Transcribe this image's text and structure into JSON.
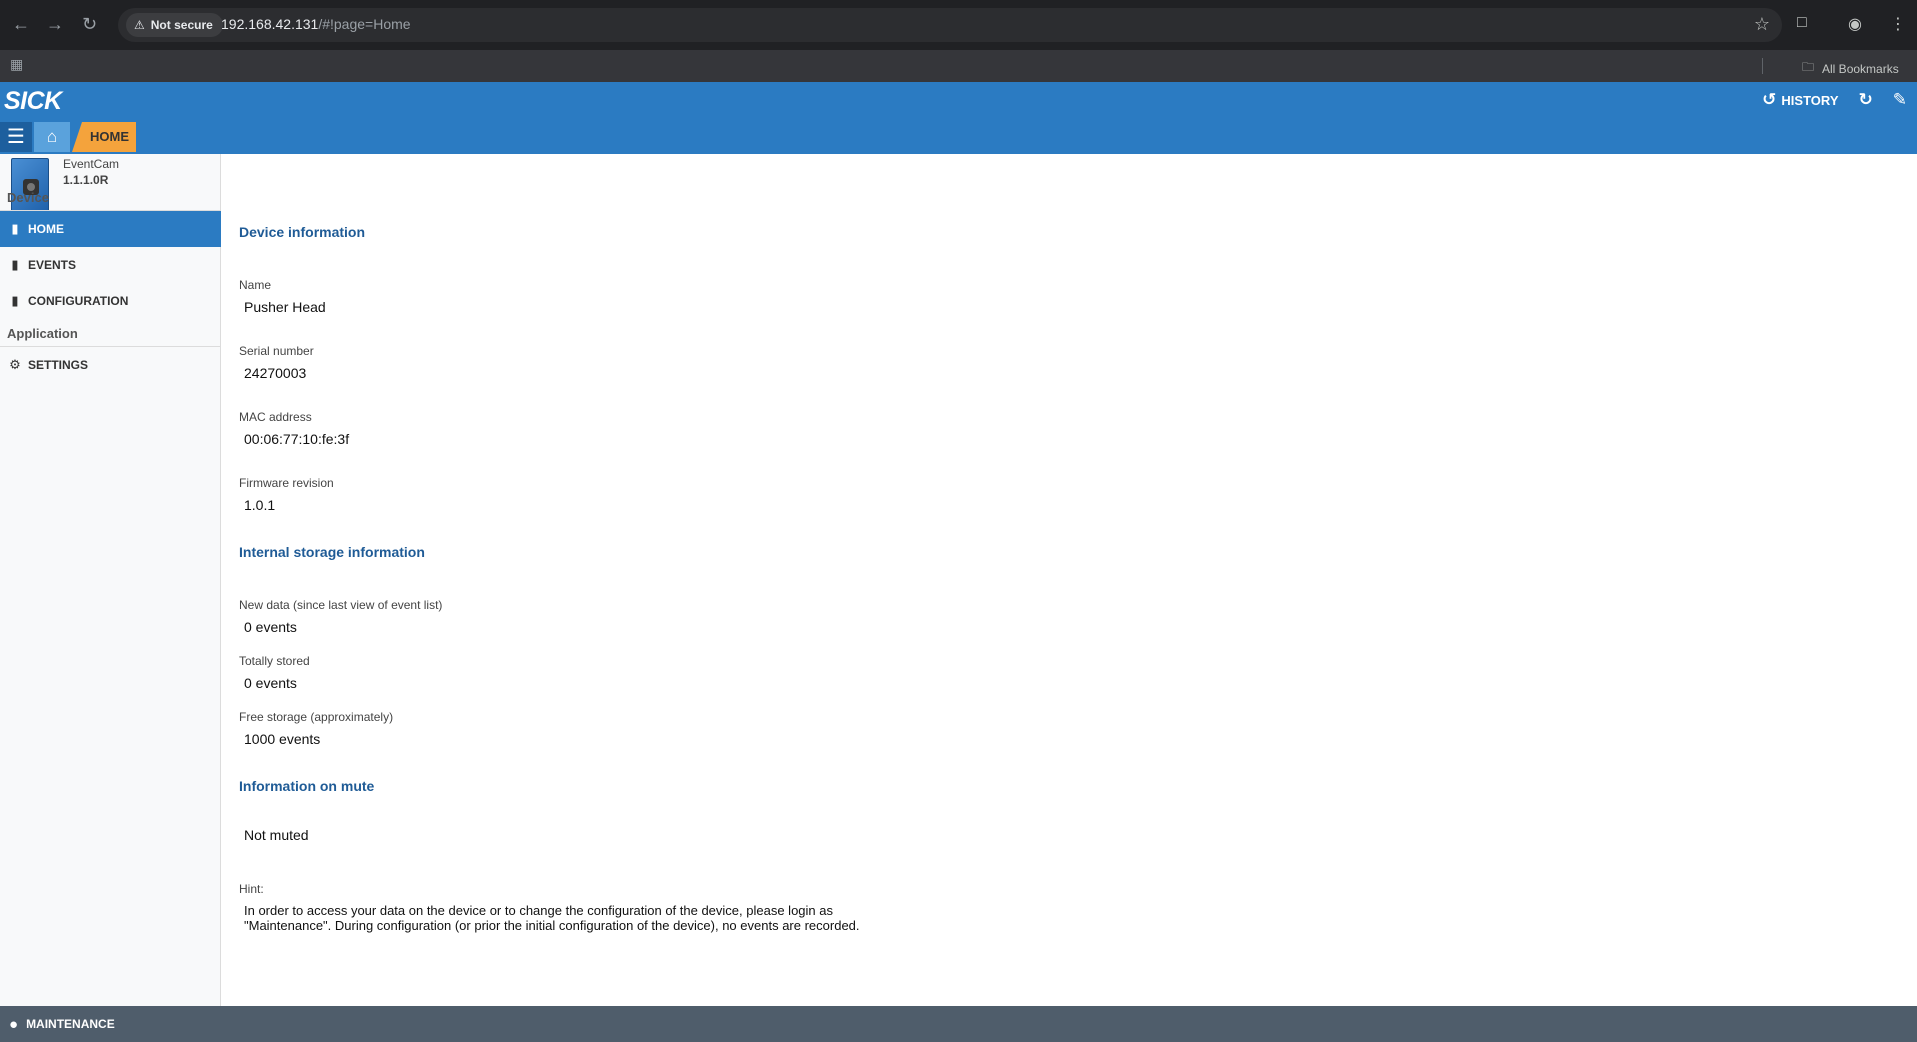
{
  "browser": {
    "security_label": "Not secure",
    "url_host": "192.168.42.131",
    "url_path": "/#!page=Home",
    "bookmarks_label": "All Bookmarks"
  },
  "header": {
    "logo": "SICK",
    "history_label": "HISTORY",
    "breadcrumb": "HOME"
  },
  "device": {
    "model": "EventCam",
    "version": "1.1.1.0R"
  },
  "sidebar": {
    "device_section": "Device",
    "application_section": "Application",
    "items": [
      {
        "label": "HOME"
      },
      {
        "label": "EVENTS"
      },
      {
        "label": "CONFIGURATION"
      },
      {
        "label": "SETTINGS"
      }
    ]
  },
  "main": {
    "device_info": {
      "title": "Device information",
      "name_label": "Name",
      "name_value": "Pusher Head",
      "serial_label": "Serial number",
      "serial_value": "24270003",
      "mac_label": "MAC address",
      "mac_value": "00:06:77:10:fe:3f",
      "firmware_label": "Firmware revision",
      "firmware_value": "1.0.1"
    },
    "storage": {
      "title": "Internal storage information",
      "new_label": "New data (since last view of event list)",
      "new_value": "0 events",
      "total_label": "Totally stored",
      "total_value": "0 events",
      "free_label": "Free storage (approximately)",
      "free_value": "1000 events"
    },
    "mute": {
      "title": "Information on mute",
      "value": "Not muted"
    },
    "hint": {
      "label": "Hint:",
      "text": "In order to access your data on the device or to change the configuration of the device, please login as \"Maintenance\". During configuration (or prior the initial configuration of the device), no events are recorded."
    }
  },
  "footer": {
    "user_label": "MAINTENANCE"
  },
  "colors": {
    "brand_blue": "#2b7bc2",
    "breadcrumb_orange": "#f4a33c",
    "section_title": "#1f5b96",
    "footer_bg": "#4f5d6b"
  }
}
